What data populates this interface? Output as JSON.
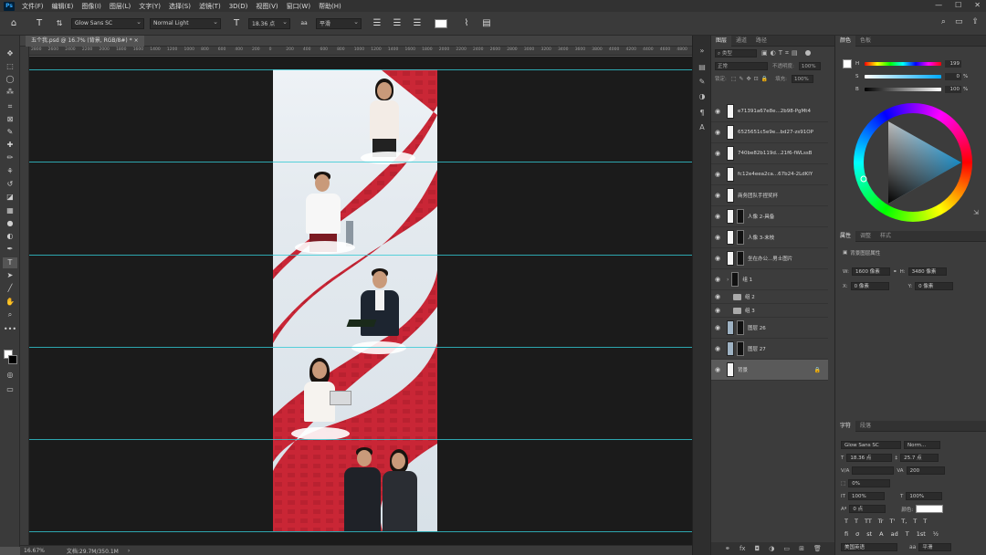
{
  "app": {
    "logo": "Ps"
  },
  "menu": [
    "文件(F)",
    "编辑(E)",
    "图像(I)",
    "图层(L)",
    "文字(Y)",
    "选择(S)",
    "滤镜(T)",
    "3D(D)",
    "视图(V)",
    "窗口(W)",
    "帮助(H)"
  ],
  "options": {
    "font_family": "Glow Sans SC",
    "font_style": "Normal Light",
    "font_size": "18.36 点",
    "anti_alias": "平滑"
  },
  "document": {
    "tab_title": "五个我.psd @ 16.7% (背景, RGB/8#) *",
    "zoom": "16.67%",
    "doc_size": "文档:29.7M/350.1M"
  },
  "ruler_ticks": [
    "2800",
    "2600",
    "2400",
    "2200",
    "2000",
    "1800",
    "1600",
    "1400",
    "1200",
    "1000",
    "800",
    "600",
    "400",
    "200",
    "0",
    "200",
    "400",
    "600",
    "800",
    "1000",
    "1200",
    "1400",
    "1600",
    "1800",
    "2000",
    "2200",
    "2400",
    "2600",
    "2800",
    "3000",
    "3200",
    "3400",
    "3600",
    "3800",
    "4000",
    "4200",
    "4400",
    "4600",
    "4800"
  ],
  "layers_panel": {
    "tabs": [
      "图层",
      "通道",
      "路径"
    ],
    "filter": "类型",
    "blend_mode": "正常",
    "opacity_label": "不透明度:",
    "opacity": "100%",
    "lock_label": "锁定:",
    "fill_label": "填充:",
    "fill": "100%",
    "layers": [
      {
        "name": "e71391a67e8e...2b98-PgMt4",
        "kind": "image"
      },
      {
        "name": "6525651c5e9e...bd27-zs91OP",
        "kind": "image"
      },
      {
        "name": "740be82b119d...21f6-fWLssB",
        "kind": "image"
      },
      {
        "name": "fc12e4eea2ca...67b24-2LdKIY",
        "kind": "image"
      },
      {
        "name": "商务团队手捏奖杯",
        "kind": "image"
      },
      {
        "name": "人像 2-具备",
        "kind": "masked"
      },
      {
        "name": "人像 3-末枝",
        "kind": "masked"
      },
      {
        "name": "坐在办公...男士图片",
        "kind": "masked"
      },
      {
        "name": "组 1",
        "kind": "group"
      },
      {
        "name": "组 2",
        "kind": "group"
      },
      {
        "name": "组 3",
        "kind": "group"
      },
      {
        "name": "图层 26",
        "kind": "masked"
      },
      {
        "name": "图层 27",
        "kind": "masked"
      },
      {
        "name": "背景",
        "kind": "background"
      }
    ]
  },
  "color_panel": {
    "tabs": [
      "颜色",
      "色板"
    ],
    "h_label": "H",
    "s_label": "S",
    "b_label": "B",
    "h": "199",
    "s": "0",
    "b": "100",
    "pct": "%",
    "accent": "#32c9d4"
  },
  "properties_panel": {
    "tabs": [
      "属性",
      "调整",
      "样式"
    ],
    "title": "背景图层属性",
    "w_label": "W:",
    "w": "1600 像素",
    "h_label": "H:",
    "h": "3480 像素",
    "x_label": "X:",
    "x": "0 像素",
    "y_label": "Y:",
    "y": "0 像素"
  },
  "character_panel": {
    "tabs": [
      "字符",
      "段落"
    ],
    "font_family": "Glow Sans SC",
    "font_style": "Norm...",
    "font_size": "18.36 点",
    "leading": "25.7 点",
    "kerning": "V/A",
    "tracking": "200",
    "scale_pct": "0%",
    "vscale": "100%",
    "hscale": "100%",
    "baseline": "0 点",
    "color_label": "颜色:",
    "language": "美国英语",
    "aa": "平滑",
    "faux_styles": [
      "T",
      "T",
      "TT",
      "Tr",
      "T'",
      "T,",
      "T",
      "T"
    ],
    "opentype": [
      "fi",
      "σ",
      "st",
      "A",
      "ad",
      "T",
      "1st",
      "½"
    ]
  }
}
